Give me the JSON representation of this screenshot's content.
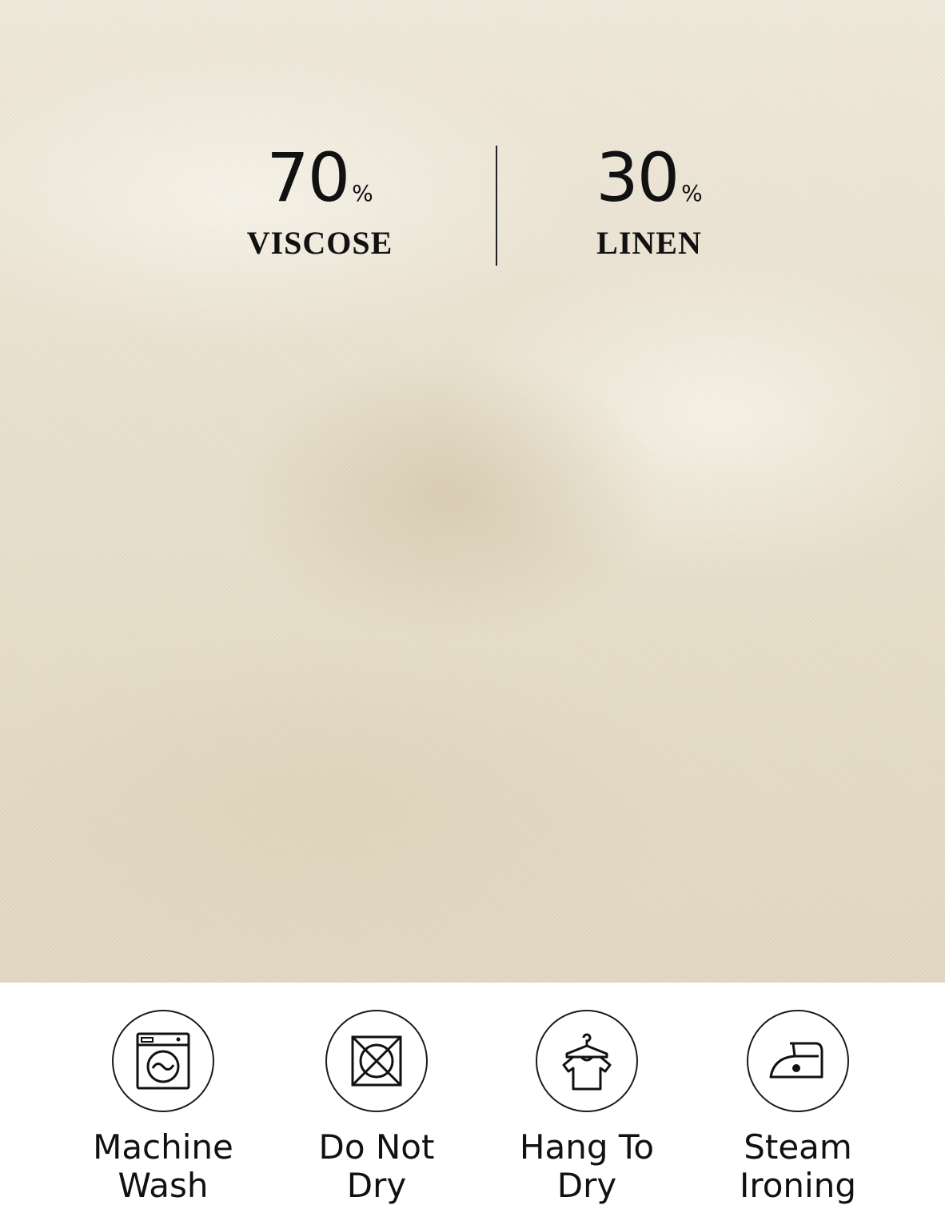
{
  "composition": [
    {
      "number": "70",
      "unit": "%",
      "label": "VISCOSE"
    },
    {
      "number": "30",
      "unit": "%",
      "label": "LINEN"
    }
  ],
  "care": [
    {
      "icon": "washing-machine-icon",
      "line1": "Machine",
      "line2": "Wash"
    },
    {
      "icon": "do-not-tumble-dry-icon",
      "line1": "Do Not",
      "line2": "Dry"
    },
    {
      "icon": "hang-dry-icon",
      "line1": "Hang To",
      "line2": "Dry"
    },
    {
      "icon": "steam-iron-icon",
      "line1": "Steam",
      "line2": "Ironing"
    }
  ],
  "colors": {
    "fabric": "#e8e0cd",
    "ink": "#111111",
    "panel": "#ffffff"
  }
}
